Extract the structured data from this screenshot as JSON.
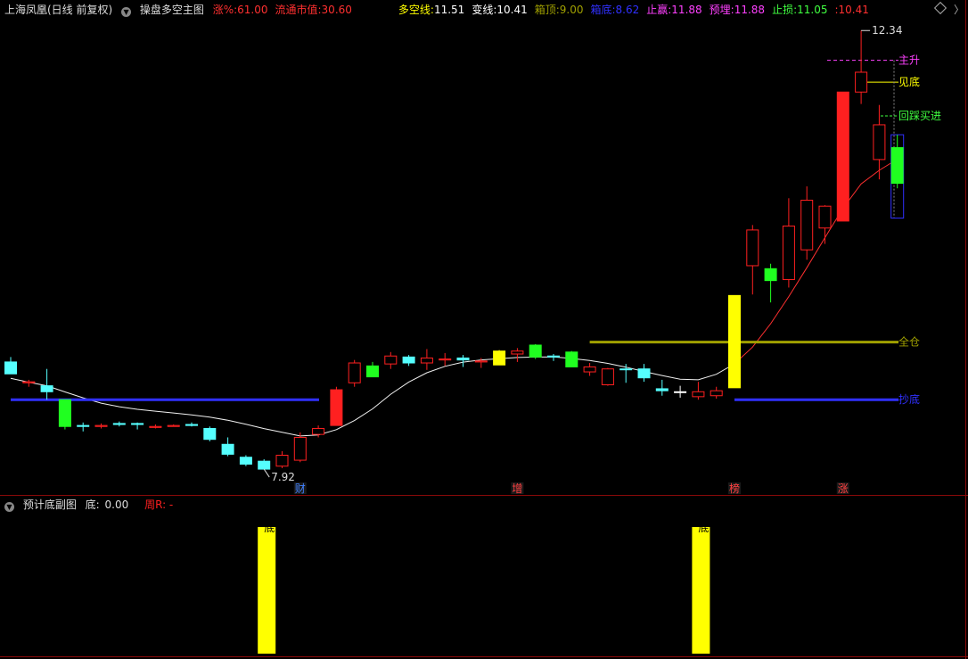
{
  "main_header": {
    "stock": "上海凤凰(日线 前复权)",
    "indicator": "操盘多空主图",
    "items": [
      {
        "label": "涨%:",
        "value": "61.00",
        "color": "#ff3030"
      },
      {
        "label": "流通市值:",
        "value": "30.60",
        "color": "#ff3030"
      },
      {
        "label": "多空线:",
        "value": "11.51",
        "color": "#ffff00"
      },
      {
        "label": "变线:",
        "value": "10.41",
        "color": "#ffffff"
      },
      {
        "label": "箱顶:",
        "value": "9.00",
        "color": "#a0a000"
      },
      {
        "label": "箱底:",
        "value": "8.62",
        "color": "#3030ff"
      },
      {
        "label": "止赢:",
        "value": "11.88",
        "color": "#ff40ff"
      },
      {
        "label": "预埋:",
        "value": "11.88",
        "color": "#ff40ff"
      },
      {
        "label": "止损:",
        "value": "11.05",
        "color": "#40ff40"
      },
      {
        "label": ":",
        "value": "10.41",
        "color": "#ff3030"
      }
    ]
  },
  "sub_header": {
    "indicator": "预计底副图",
    "item_label": "底:",
    "item_value": "0.00",
    "extra": "周R: -"
  },
  "chart_data": [
    {
      "type": "candlestick",
      "title": "操盘多空主图",
      "ylim": [
        7.5,
        12.6
      ],
      "high_label": "12.34",
      "low_label": "7.92",
      "candles": [
        {
          "o": 9.0,
          "h": 9.05,
          "l": 8.88,
          "c": 8.88,
          "color": "cyan"
        },
        {
          "o": 8.8,
          "h": 8.82,
          "l": 8.75,
          "c": 8.79,
          "color": "red"
        },
        {
          "o": 8.76,
          "h": 8.93,
          "l": 8.62,
          "c": 8.7,
          "color": "cyan"
        },
        {
          "o": 8.62,
          "h": 8.62,
          "l": 8.32,
          "c": 8.35,
          "color": "green"
        },
        {
          "o": 8.36,
          "h": 8.39,
          "l": 8.3,
          "c": 8.35,
          "color": "cyan"
        },
        {
          "o": 8.36,
          "h": 8.38,
          "l": 8.33,
          "c": 8.35,
          "color": "red"
        },
        {
          "o": 8.38,
          "h": 8.4,
          "l": 8.35,
          "c": 8.37,
          "color": "cyan"
        },
        {
          "o": 8.38,
          "h": 8.39,
          "l": 8.32,
          "c": 8.37,
          "color": "cyan"
        },
        {
          "o": 8.35,
          "h": 8.37,
          "l": 8.33,
          "c": 8.34,
          "color": "red"
        },
        {
          "o": 8.36,
          "h": 8.37,
          "l": 8.35,
          "c": 8.35,
          "color": "red"
        },
        {
          "o": 8.37,
          "h": 8.39,
          "l": 8.35,
          "c": 8.36,
          "color": "cyan"
        },
        {
          "o": 8.33,
          "h": 8.35,
          "l": 8.2,
          "c": 8.22,
          "color": "cyan"
        },
        {
          "o": 8.17,
          "h": 8.24,
          "l": 8.05,
          "c": 8.07,
          "color": "cyan"
        },
        {
          "o": 8.04,
          "h": 8.06,
          "l": 7.95,
          "c": 7.97,
          "color": "cyan"
        },
        {
          "o": 8.0,
          "h": 8.02,
          "l": 7.92,
          "c": 7.92,
          "color": "cyan"
        },
        {
          "o": 7.95,
          "h": 8.1,
          "l": 7.93,
          "c": 8.06,
          "color": "red"
        },
        {
          "o": 8.01,
          "h": 8.29,
          "l": 7.99,
          "c": 8.24,
          "color": "red"
        },
        {
          "o": 8.27,
          "h": 8.36,
          "l": 8.24,
          "c": 8.33,
          "color": "red"
        },
        {
          "o": 8.36,
          "h": 8.75,
          "l": 8.36,
          "c": 8.72,
          "color": "red"
        },
        {
          "o": 8.79,
          "h": 9.02,
          "l": 8.75,
          "c": 8.99,
          "color": "red"
        },
        {
          "o": 8.96,
          "h": 9.0,
          "l": 8.85,
          "c": 8.85,
          "color": "green"
        },
        {
          "o": 8.98,
          "h": 9.1,
          "l": 8.93,
          "c": 9.06,
          "color": "red"
        },
        {
          "o": 9.05,
          "h": 9.07,
          "l": 8.96,
          "c": 8.99,
          "color": "cyan"
        },
        {
          "o": 8.99,
          "h": 9.13,
          "l": 8.92,
          "c": 9.04,
          "color": "red"
        },
        {
          "o": 9.02,
          "h": 9.09,
          "l": 8.96,
          "c": 9.03,
          "color": "red"
        },
        {
          "o": 9.04,
          "h": 9.07,
          "l": 8.95,
          "c": 9.02,
          "color": "cyan"
        },
        {
          "o": 9.0,
          "h": 9.04,
          "l": 8.94,
          "c": 9.01,
          "color": "red"
        },
        {
          "o": 8.97,
          "h": 9.12,
          "l": 8.97,
          "c": 9.11,
          "color": "yellow"
        },
        {
          "o": 9.08,
          "h": 9.14,
          "l": 9.0,
          "c": 9.11,
          "color": "red"
        },
        {
          "o": 9.17,
          "h": 9.18,
          "l": 9.03,
          "c": 9.05,
          "color": "green"
        },
        {
          "o": 9.06,
          "h": 9.08,
          "l": 9.01,
          "c": 9.05,
          "color": "cyan"
        },
        {
          "o": 9.1,
          "h": 9.11,
          "l": 8.95,
          "c": 8.95,
          "color": "green"
        },
        {
          "o": 8.9,
          "h": 8.99,
          "l": 8.86,
          "c": 8.95,
          "color": "red"
        },
        {
          "o": 8.93,
          "h": 8.94,
          "l": 8.76,
          "c": 8.77,
          "color": "red"
        },
        {
          "o": 8.93,
          "h": 8.98,
          "l": 8.79,
          "c": 8.93,
          "color": "cyan"
        },
        {
          "o": 8.93,
          "h": 8.98,
          "l": 8.8,
          "c": 8.84,
          "color": "cyan"
        },
        {
          "o": 8.73,
          "h": 8.82,
          "l": 8.66,
          "c": 8.71,
          "color": "cyan"
        },
        {
          "o": 8.7,
          "h": 8.76,
          "l": 8.64,
          "c": 8.7,
          "color": "white"
        },
        {
          "o": 8.65,
          "h": 8.8,
          "l": 8.62,
          "c": 8.7,
          "color": "red"
        },
        {
          "o": 8.66,
          "h": 8.75,
          "l": 8.63,
          "c": 8.71,
          "color": "red"
        },
        {
          "o": 8.74,
          "h": 9.67,
          "l": 8.74,
          "c": 9.67,
          "color": "yellow"
        },
        {
          "o": 9.97,
          "h": 10.38,
          "l": 9.68,
          "c": 10.33,
          "color": "red"
        },
        {
          "o": 9.82,
          "h": 9.99,
          "l": 9.6,
          "c": 9.94,
          "color": "green"
        },
        {
          "o": 9.83,
          "h": 10.65,
          "l": 9.75,
          "c": 10.37,
          "color": "red"
        },
        {
          "o": 10.13,
          "h": 10.77,
          "l": 10.03,
          "c": 10.63,
          "color": "red"
        },
        {
          "o": 10.35,
          "h": 10.58,
          "l": 10.19,
          "c": 10.57,
          "color": "red"
        },
        {
          "o": 10.42,
          "h": 11.72,
          "l": 10.42,
          "c": 11.72,
          "color": "red"
        },
        {
          "o": 11.72,
          "h": 12.34,
          "l": 11.6,
          "c": 11.92,
          "color": "red"
        },
        {
          "o": 11.04,
          "h": 11.59,
          "l": 10.84,
          "c": 11.39,
          "color": "red"
        },
        {
          "o": 11.16,
          "h": 11.29,
          "l": 10.75,
          "c": 10.8,
          "color": "green"
        }
      ],
      "horizontal_levels": [
        {
          "label": "全仓",
          "value": 9.2,
          "color": "#a0a000"
        },
        {
          "label": "抄底",
          "value": 8.62,
          "color": "#3030ff"
        },
        {
          "label": "主升",
          "value": 12.04,
          "color": "#ff40ff"
        },
        {
          "label": "见底",
          "value": 11.82,
          "color": "#ffff00"
        },
        {
          "label": "回踩买进",
          "value": 11.48,
          "color": "#40ff40"
        }
      ],
      "event_markers": [
        {
          "label": "财",
          "index": 16,
          "color": "#4080ff"
        },
        {
          "label": "增",
          "index": 28,
          "color": "#ff4040"
        },
        {
          "label": "榜",
          "index": 40,
          "color": "#ff4040"
        },
        {
          "label": "涨",
          "index": 46,
          "color": "#ff4040"
        }
      ]
    },
    {
      "type": "bar",
      "title": "预计底副图",
      "series": [
        {
          "name": "底",
          "values": [
            {
              "index": 14,
              "value": 1
            },
            {
              "index": 38,
              "value": 1
            }
          ],
          "color": "#ffff00"
        }
      ]
    }
  ]
}
